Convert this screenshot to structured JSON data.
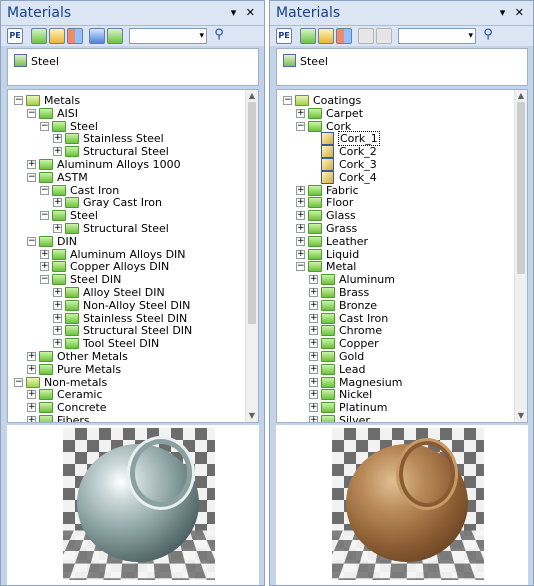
{
  "left": {
    "title": "Materials",
    "controls": "▾ ✕",
    "selected": "Steel",
    "tree": [
      {
        "label": "Metals",
        "depth": 0,
        "expander": "−",
        "icon": "group"
      },
      {
        "label": "AISI",
        "depth": 1,
        "expander": "−",
        "icon": "folder"
      },
      {
        "label": "Steel",
        "depth": 2,
        "expander": "−",
        "icon": "folder"
      },
      {
        "label": "Stainless Steel",
        "depth": 3,
        "expander": "+",
        "icon": "folder"
      },
      {
        "label": "Structural Steel",
        "depth": 3,
        "expander": "+",
        "icon": "folder"
      },
      {
        "label": "Aluminum Alloys 1000",
        "depth": 1,
        "expander": "+",
        "icon": "folder"
      },
      {
        "label": "ASTM",
        "depth": 1,
        "expander": "−",
        "icon": "folder"
      },
      {
        "label": "Cast Iron",
        "depth": 2,
        "expander": "−",
        "icon": "folder"
      },
      {
        "label": "Gray Cast Iron",
        "depth": 3,
        "expander": "+",
        "icon": "folder"
      },
      {
        "label": "Steel",
        "depth": 2,
        "expander": "−",
        "icon": "folder"
      },
      {
        "label": "Structural Steel",
        "depth": 3,
        "expander": "+",
        "icon": "folder"
      },
      {
        "label": "DIN",
        "depth": 1,
        "expander": "−",
        "icon": "folder"
      },
      {
        "label": "Aluminum Alloys DIN",
        "depth": 2,
        "expander": "+",
        "icon": "folder"
      },
      {
        "label": "Copper Alloys DIN",
        "depth": 2,
        "expander": "+",
        "icon": "folder"
      },
      {
        "label": "Steel DIN",
        "depth": 2,
        "expander": "−",
        "icon": "folder"
      },
      {
        "label": "Alloy Steel DIN",
        "depth": 3,
        "expander": "+",
        "icon": "folder"
      },
      {
        "label": "Non-Alloy Steel DIN",
        "depth": 3,
        "expander": "+",
        "icon": "folder"
      },
      {
        "label": "Stainless Steel DIN",
        "depth": 3,
        "expander": "+",
        "icon": "folder"
      },
      {
        "label": "Structural Steel DIN",
        "depth": 3,
        "expander": "+",
        "icon": "folder"
      },
      {
        "label": "Tool Steel DIN",
        "depth": 3,
        "expander": "+",
        "icon": "folder"
      },
      {
        "label": "Other Metals",
        "depth": 1,
        "expander": "+",
        "icon": "folder"
      },
      {
        "label": "Pure Metals",
        "depth": 1,
        "expander": "+",
        "icon": "folder"
      },
      {
        "label": "Non-metals",
        "depth": 0,
        "expander": "−",
        "icon": "group"
      },
      {
        "label": "Ceramic",
        "depth": 1,
        "expander": "+",
        "icon": "folder"
      },
      {
        "label": "Concrete",
        "depth": 1,
        "expander": "+",
        "icon": "folder"
      },
      {
        "label": "Fibers",
        "depth": 1,
        "expander": "+",
        "icon": "folder"
      }
    ],
    "scroll_fraction": 0.72
  },
  "right": {
    "title": "Materials",
    "controls": "▾ ✕",
    "selected": "Steel",
    "tree": [
      {
        "label": "Coatings",
        "depth": 0,
        "expander": "−",
        "icon": "group"
      },
      {
        "label": "Carpet",
        "depth": 1,
        "expander": "+",
        "icon": "folder"
      },
      {
        "label": "Cork",
        "depth": 1,
        "expander": "−",
        "icon": "folder"
      },
      {
        "label": "Cork_1",
        "depth": 2,
        "expander": "",
        "icon": "material",
        "selected": true
      },
      {
        "label": "Cork_2",
        "depth": 2,
        "expander": "",
        "icon": "material"
      },
      {
        "label": "Cork_3",
        "depth": 2,
        "expander": "",
        "icon": "material"
      },
      {
        "label": "Cork_4",
        "depth": 2,
        "expander": "",
        "icon": "material"
      },
      {
        "label": "Fabric",
        "depth": 1,
        "expander": "+",
        "icon": "folder"
      },
      {
        "label": "Floor",
        "depth": 1,
        "expander": "+",
        "icon": "folder"
      },
      {
        "label": "Glass",
        "depth": 1,
        "expander": "+",
        "icon": "folder"
      },
      {
        "label": "Grass",
        "depth": 1,
        "expander": "+",
        "icon": "folder"
      },
      {
        "label": "Leather",
        "depth": 1,
        "expander": "+",
        "icon": "folder"
      },
      {
        "label": "Liquid",
        "depth": 1,
        "expander": "+",
        "icon": "folder"
      },
      {
        "label": "Metal",
        "depth": 1,
        "expander": "−",
        "icon": "folder"
      },
      {
        "label": "Aluminum",
        "depth": 2,
        "expander": "+",
        "icon": "folder"
      },
      {
        "label": "Brass",
        "depth": 2,
        "expander": "+",
        "icon": "folder"
      },
      {
        "label": "Bronze",
        "depth": 2,
        "expander": "+",
        "icon": "folder"
      },
      {
        "label": "Cast Iron",
        "depth": 2,
        "expander": "+",
        "icon": "folder"
      },
      {
        "label": "Chrome",
        "depth": 2,
        "expander": "+",
        "icon": "folder"
      },
      {
        "label": "Copper",
        "depth": 2,
        "expander": "+",
        "icon": "folder"
      },
      {
        "label": "Gold",
        "depth": 2,
        "expander": "+",
        "icon": "folder"
      },
      {
        "label": "Lead",
        "depth": 2,
        "expander": "+",
        "icon": "folder"
      },
      {
        "label": "Magnesium",
        "depth": 2,
        "expander": "+",
        "icon": "folder"
      },
      {
        "label": "Nickel",
        "depth": 2,
        "expander": "+",
        "icon": "folder"
      },
      {
        "label": "Platinum",
        "depth": 2,
        "expander": "+",
        "icon": "folder"
      },
      {
        "label": "Silver",
        "depth": 2,
        "expander": "+",
        "icon": "folder"
      }
    ],
    "scroll_fraction": 0.56
  },
  "icons": {
    "toolbar": [
      "properties-editor-icon",
      "add-material-icon",
      "add-folder-icon",
      "library-icon",
      "copy-icon",
      "paste-icon"
    ],
    "search": "search-icon",
    "combo_arrow": "chevron-down-icon"
  },
  "toolbar_pe_label": "PE",
  "preview": {
    "left": "steel",
    "right": "cork"
  }
}
